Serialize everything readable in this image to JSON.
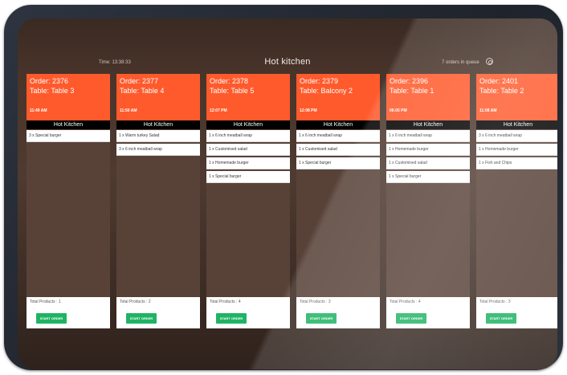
{
  "header": {
    "time_text": "Time: 13:38:33",
    "title": "Hot kitchen",
    "queue_text": "7 orders in queue"
  },
  "orders": [
    {
      "order_label": "Order: 2376",
      "table_label": "Table: Table 3",
      "time": "11:49 AM",
      "station": "Hot Kitchen",
      "items": [
        "3 x Special burger"
      ],
      "total": "Total Products : 1",
      "button": "START ORDER"
    },
    {
      "order_label": "Order: 2377",
      "table_label": "Table: Table 4",
      "time": "11:50 AM",
      "station": "Hot Kitchen",
      "items": [
        "1 x Warm turkey Salad",
        "3 x 6 inch meatball wrap"
      ],
      "total": "Total Products : 2",
      "button": "START ORDER"
    },
    {
      "order_label": "Order: 2378",
      "table_label": "Table: Table 5",
      "time": "12:07 PM",
      "station": "Hot Kitchen",
      "items": [
        "1 x 6 inch meatball wrap",
        "1 x Customised salad",
        "1 x Homemade burger",
        "1 x Special burger"
      ],
      "total": "Total Products : 4",
      "button": "START ORDER"
    },
    {
      "order_label": "Order: 2379",
      "table_label": "Table: Balcony 2",
      "time": "12:08 PM",
      "station": "Hot Kitchen",
      "items": [
        "1 x 6 inch meatball wrap",
        "1 x Customised salad",
        "1 x Special burger"
      ],
      "total": "Total Products : 3",
      "button": "START ORDER"
    },
    {
      "order_label": "Order: 2396",
      "table_label": "Table: Table 1",
      "time": "06:05 PM",
      "station": "Hot Kitchen",
      "items": [
        "1 x 6 inch meatball wrap",
        "1 x Homemade burger",
        "1 x Customised salad",
        "1 x Special burger"
      ],
      "total": "Total Products : 4",
      "button": "START ORDER"
    },
    {
      "order_label": "Order: 2401",
      "table_label": "Table: Table 2",
      "time": "11:08 AM",
      "station": "Hot Kitchen",
      "items": [
        "3 x 6 inch meatball wrap",
        "1 x Homemade burger",
        "1 x Fish and Chips"
      ],
      "total": "Total Products : 3",
      "button": "START ORDER"
    }
  ]
}
